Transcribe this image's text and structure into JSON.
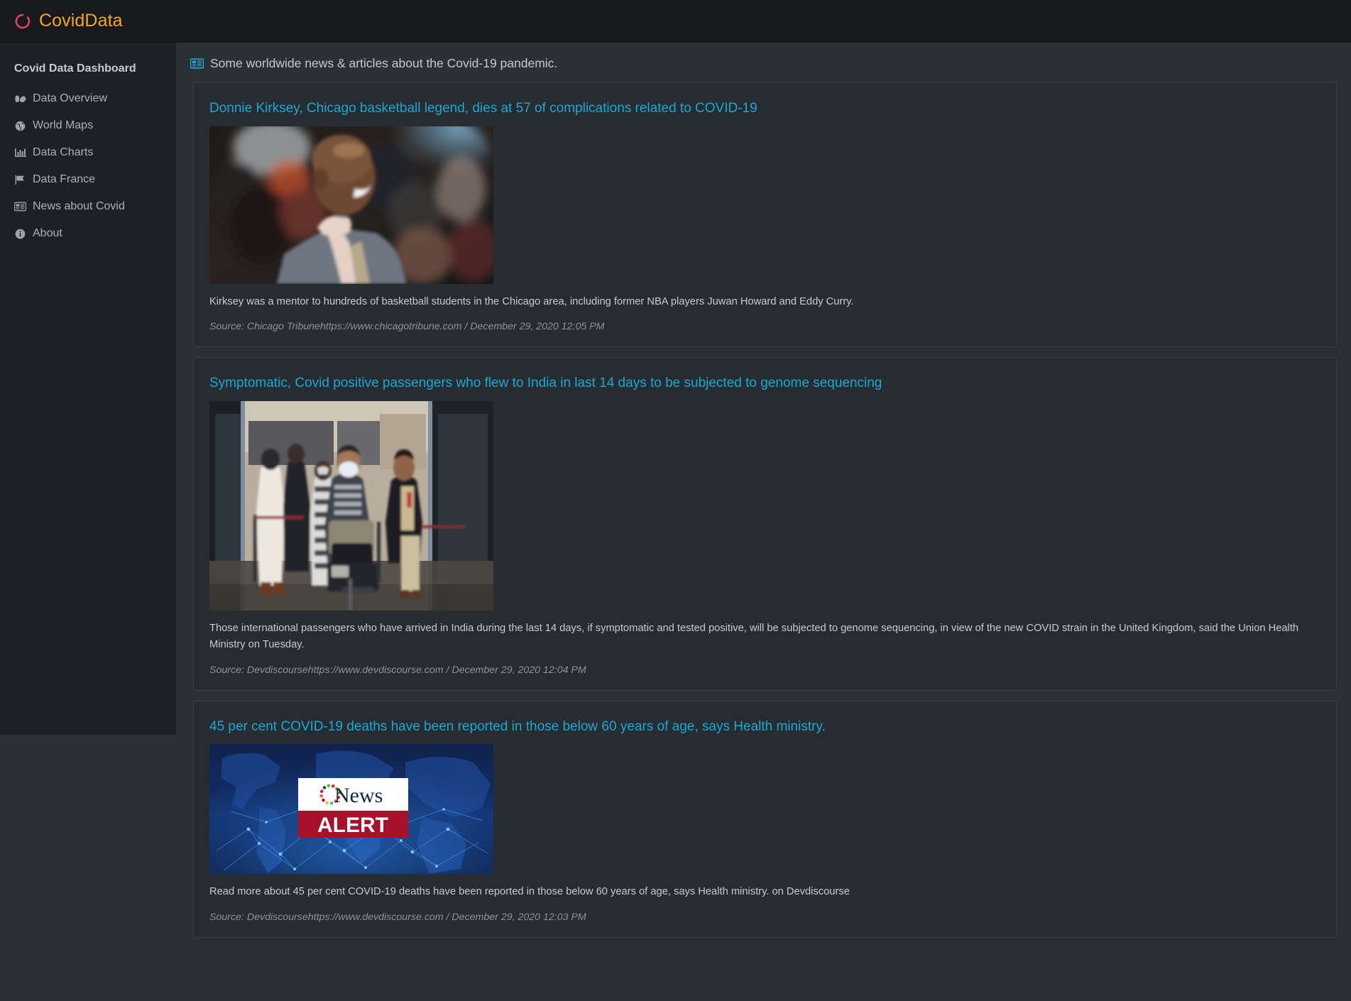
{
  "navbar": {
    "brand_text": "CovidData",
    "brand_icon": "covid-spinner-icon",
    "brand_color": "#f5a623",
    "logo_color": "#e8405e"
  },
  "sidebar": {
    "title": "Covid Data Dashboard",
    "items": [
      {
        "label": "Data Overview",
        "icon": "pills-icon"
      },
      {
        "label": "World Maps",
        "icon": "globe-icon"
      },
      {
        "label": "Data Charts",
        "icon": "bar-chart-icon"
      },
      {
        "label": "Data France",
        "icon": "flag-icon"
      },
      {
        "label": "News about Covid",
        "icon": "newspaper-icon"
      },
      {
        "label": "About",
        "icon": "info-circle-icon"
      }
    ]
  },
  "main": {
    "header_icon": "newspaper-icon",
    "header_text": "Some worldwide news & articles about the Covid-19 pandemic.",
    "accent_color": "#1ba8d6",
    "articles": [
      {
        "title": "Donnie Kirksey, Chicago basketball legend, dies at 57 of complications related to COVID-19",
        "image": "photo-man-gray-suit-basketball-crowd",
        "description": "Kirksey was a mentor to hundreds of basketball students in the Chicago area, including former NBA players Juwan Howard and Eddy Curry.",
        "source": "Source: Chicago Tribunehttps://www.chicagotribune.com / December 29, 2020 12:05 PM"
      },
      {
        "title": "Symptomatic, Covid positive passengers who flew to India in last 14 days to be subjected to genome sequencing",
        "image": "photo-airport-arrivals-masked-passengers",
        "description": "Those international passengers who have arrived in India during the last 14 days, if symptomatic and tested positive, will be subjected to genome sequencing, in view of the new COVID strain in the United Kingdom, said the Union Health Ministry on Tuesday.",
        "source": "Source: Devdiscoursehttps://www.devdiscourse.com / December 29, 2020 12:04 PM"
      },
      {
        "title": "45 per cent COVID-19 deaths have been reported in those below 60 years of age, says Health ministry.",
        "image": "graphic-news-alert-world-map",
        "image_text_top": "News",
        "image_text_bottom": "ALERT",
        "description": "Read more about 45 per cent COVID-19 deaths have been reported in those below 60 years of age, says Health ministry. on Devdiscourse",
        "source": "Source: Devdiscoursehttps://www.devdiscourse.com / December 29, 2020 12:03 PM"
      }
    ]
  }
}
